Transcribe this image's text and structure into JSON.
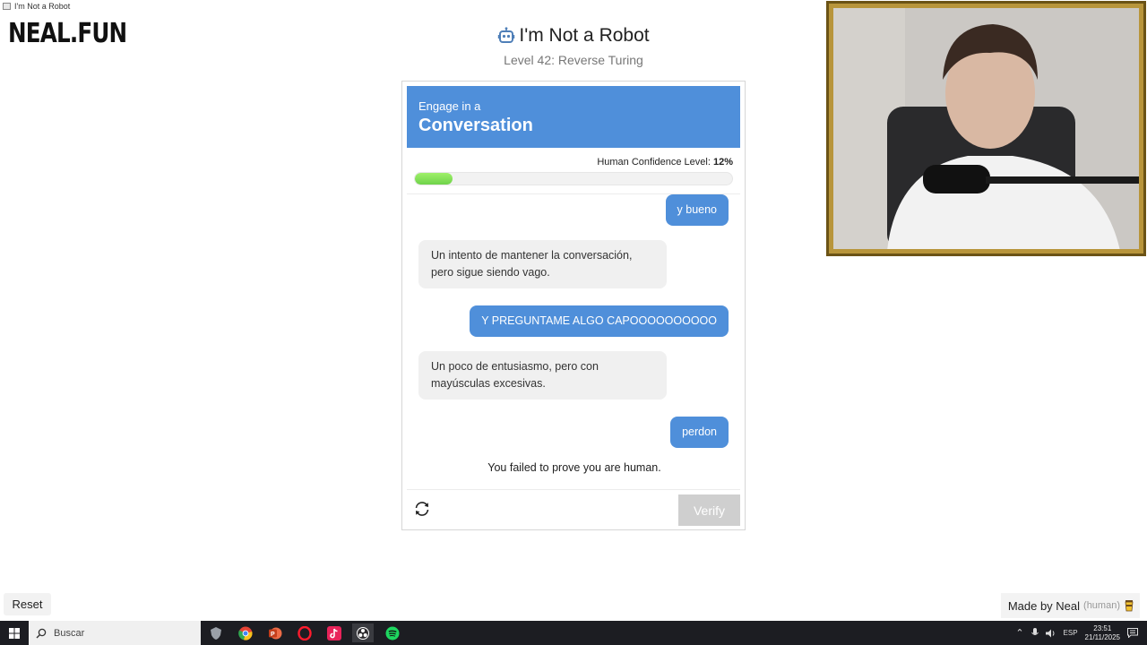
{
  "window": {
    "title": "I'm Not a Robot"
  },
  "logo": "NEAL.FUN",
  "header": {
    "title": "I'm Not a Robot",
    "subtitle": "Level 42: Reverse Turing"
  },
  "card": {
    "header_small": "Engage in a",
    "header_big": "Conversation",
    "confidence_label": "Human Confidence Level:",
    "confidence_value": "12%",
    "confidence_fraction": 0.12,
    "messages": [
      {
        "role": "user",
        "text": "y bueno"
      },
      {
        "role": "bot",
        "text": "Un intento de mantener la conversación, pero sigue siendo vago."
      },
      {
        "role": "user",
        "text": "Y PREGUNTAME ALGO CAPOOOOOOOOOO"
      },
      {
        "role": "bot",
        "text": "Un poco de entusiasmo, pero con mayúsculas excesivas."
      },
      {
        "role": "user",
        "text": "perdon"
      }
    ],
    "failed_text": "You failed to prove you are human.",
    "verify_label": "Verify"
  },
  "footer": {
    "reset_label": "Reset",
    "made_by": "Made by Neal",
    "made_by_note": "(human)"
  },
  "taskbar": {
    "search_placeholder": "Buscar",
    "language": "ESP",
    "time": "23:51",
    "date": "21/11/2025"
  },
  "colors": {
    "accent": "#4f8fda",
    "progress": "#8ee45a",
    "verify_disabled": "#cfcfcf",
    "taskbar": "#1c1d22"
  }
}
